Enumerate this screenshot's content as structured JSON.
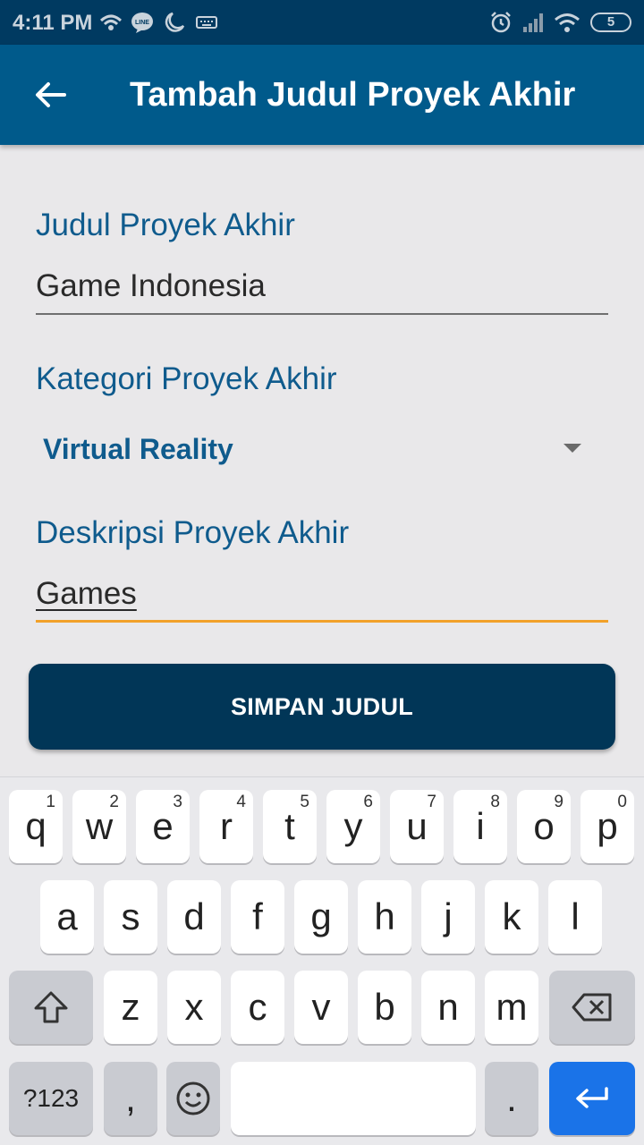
{
  "status_bar": {
    "time": "4:11 PM",
    "battery": "5"
  },
  "app_bar": {
    "title": "Tambah Judul Proyek Akhir"
  },
  "form": {
    "title_label": "Judul Proyek Akhir",
    "title_value": "Game Indonesia",
    "category_label": "Kategori Proyek Akhir",
    "category_value": "Virtual Reality",
    "description_label": "Deskripsi Proyek Akhir",
    "description_value": "Games"
  },
  "save_button": {
    "label": "SIMPAN JUDUL"
  },
  "keyboard": {
    "row1": [
      {
        "k": "q",
        "h": "1"
      },
      {
        "k": "w",
        "h": "2"
      },
      {
        "k": "e",
        "h": "3"
      },
      {
        "k": "r",
        "h": "4"
      },
      {
        "k": "t",
        "h": "5"
      },
      {
        "k": "y",
        "h": "6"
      },
      {
        "k": "u",
        "h": "7"
      },
      {
        "k": "i",
        "h": "8"
      },
      {
        "k": "o",
        "h": "9"
      },
      {
        "k": "p",
        "h": "0"
      }
    ],
    "row2": [
      "a",
      "s",
      "d",
      "f",
      "g",
      "h",
      "j",
      "k",
      "l"
    ],
    "row3": [
      "z",
      "x",
      "c",
      "v",
      "b",
      "n",
      "m"
    ],
    "symbols_label": "?123",
    "comma": ",",
    "period": "."
  },
  "colors": {
    "status_bar": "#003a61",
    "app_bar": "#005a8b",
    "accent": "#f2a12a",
    "button": "#013657",
    "label": "#0f5b8d"
  },
  "icons": [
    "hotspot-icon",
    "line-icon",
    "night-mode-icon",
    "keyboard-icon",
    "alarm-icon",
    "signal-icon",
    "wifi-icon",
    "battery-icon",
    "back-arrow-icon",
    "dropdown-caret-icon",
    "shift-icon",
    "backspace-icon",
    "emoji-icon",
    "enter-icon"
  ]
}
